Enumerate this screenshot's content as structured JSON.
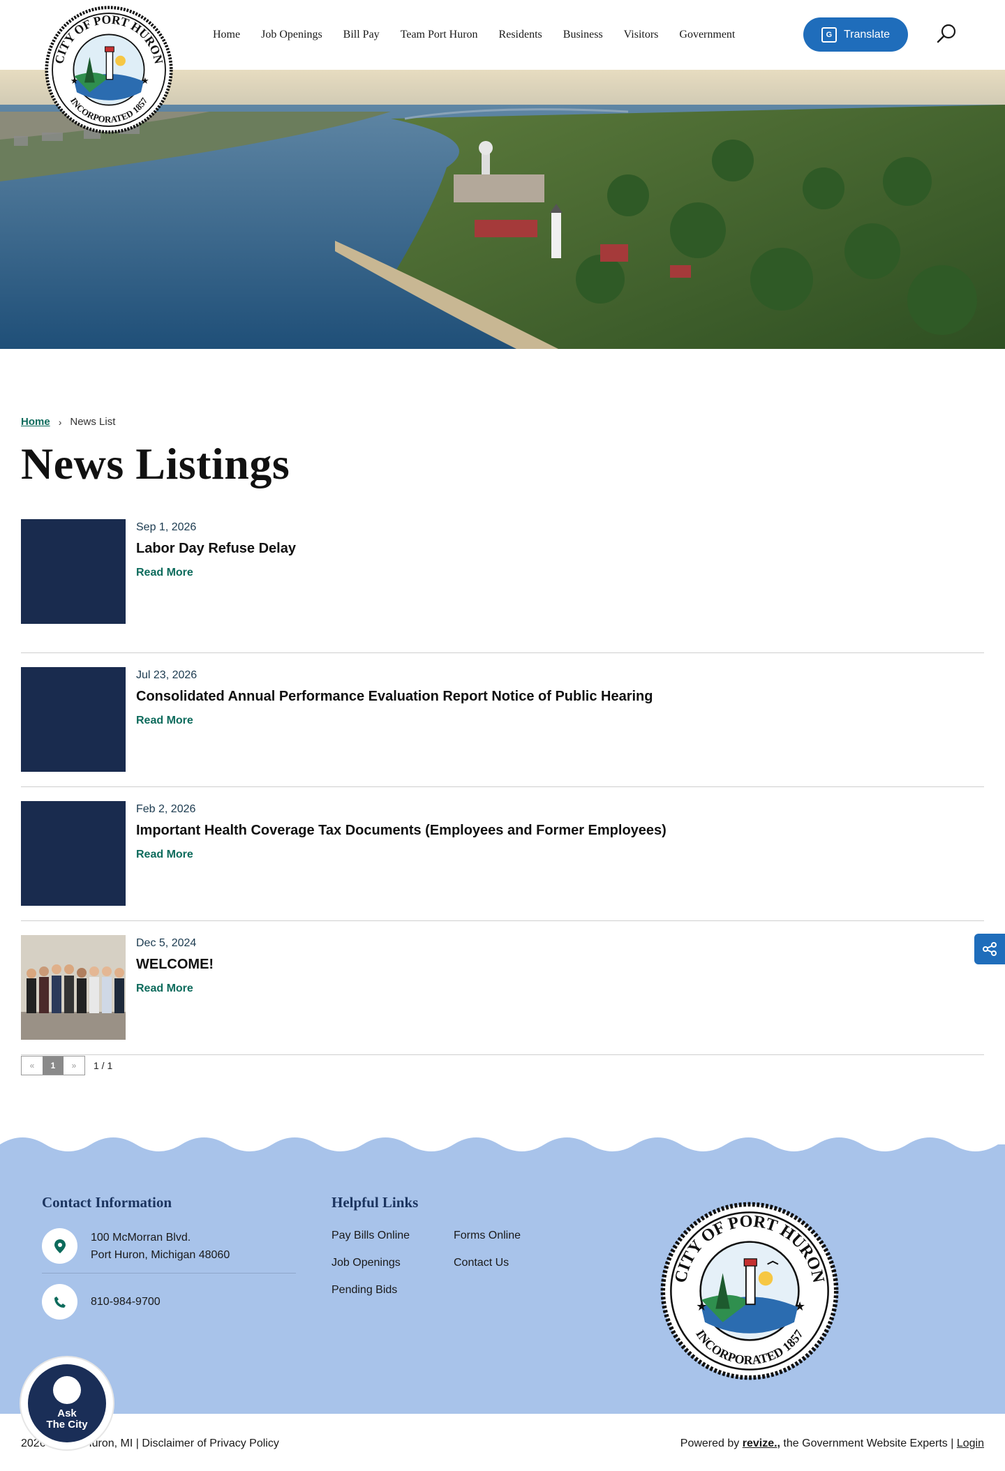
{
  "header": {
    "nav": [
      "Home",
      "Job Openings",
      "Bill Pay",
      "Team Port Huron",
      "Residents",
      "Business",
      "Visitors",
      "Government"
    ],
    "translate_label": "Translate"
  },
  "seal": {
    "top_text": "CITY OF PORT HURON",
    "bottom_text": "INCORPORATED 1857"
  },
  "breadcrumb": {
    "home": "Home",
    "current": "News List"
  },
  "page_title": "News Listings",
  "news": [
    {
      "date": "Sep 1, 2026",
      "title": "Labor Day Refuse Delay",
      "read_more": "Read More"
    },
    {
      "date": "Jul 23, 2026",
      "title": "Consolidated Annual Performance Evaluation Report Notice of Public Hearing",
      "read_more": "Read More"
    },
    {
      "date": "Feb 2, 2026",
      "title": "Important Health Coverage Tax Documents (Employees and Former Employees)",
      "read_more": "Read More"
    },
    {
      "date": "Dec 5, 2024",
      "title": "WELCOME!",
      "read_more": "Read More"
    }
  ],
  "pagination": {
    "prev": "«",
    "current": "1",
    "next": "»",
    "count": "1 / 1"
  },
  "footer": {
    "contact_heading": "Contact Information",
    "address_line1": "100 McMorran Blvd.",
    "address_line2": "Port Huron, Michigan 48060",
    "phone": "810-984-9700",
    "links_heading": "Helpful Links",
    "links": [
      "Pay Bills Online",
      "Job Openings",
      "Pending Bids",
      "Forms Online",
      "Contact Us"
    ],
    "ask_city_line1": "Ask",
    "ask_city_line2": "The City",
    "copyright": "2026 © Port Huron, MI | Disclaimer of Privacy Policy",
    "powered_prefix": "Powered by ",
    "powered_brand": "revize.,",
    "powered_suffix": " the Government Website Experts  | ",
    "login": "Login"
  },
  "colors": {
    "accent_green": "#0d6b5c",
    "nav_blue": "#1f6dbb",
    "thumb_navy": "#192b4e",
    "footer_blue": "#a8c3ea"
  }
}
